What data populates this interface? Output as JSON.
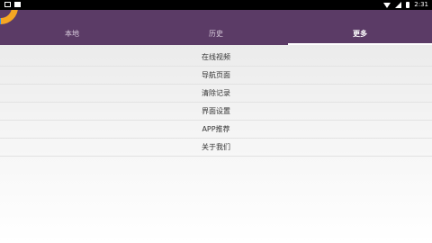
{
  "status_bar": {
    "time": "2:31",
    "icons": [
      "image-icon",
      "notification-icon",
      "wifi-icon",
      "signal-icon",
      "battery-icon"
    ]
  },
  "app_bar": {
    "background": "#5b3b66",
    "tabs": [
      {
        "label": "本地",
        "active": false
      },
      {
        "label": "历史",
        "active": false
      },
      {
        "label": "更多",
        "active": true
      }
    ]
  },
  "menu": {
    "items": [
      {
        "label": "在线视频"
      },
      {
        "label": "导航页面"
      },
      {
        "label": "清除记录"
      },
      {
        "label": "界面设置"
      },
      {
        "label": "APP推荐"
      },
      {
        "label": "关于我们"
      }
    ]
  }
}
